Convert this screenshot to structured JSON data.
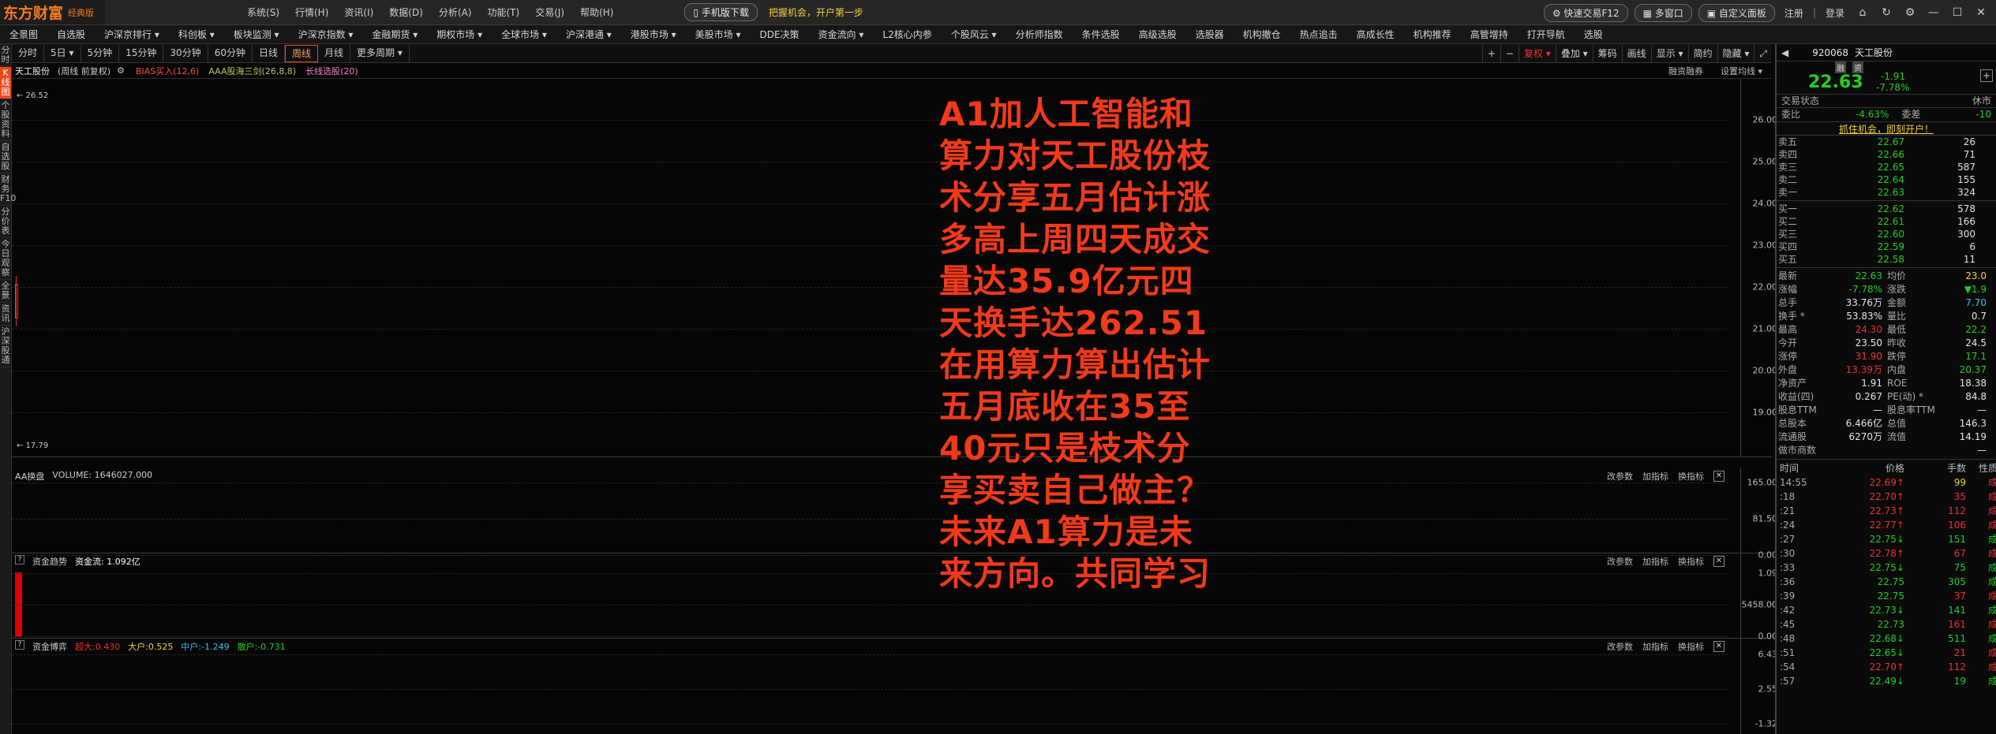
{
  "app": {
    "logo": "东方财富",
    "edition": "经典版"
  },
  "menu": [
    "系统(S)",
    "行情(H)",
    "资讯(I)",
    "数据(D)",
    "分析(A)",
    "功能(T)",
    "交易(J)",
    "帮助(H)"
  ],
  "menu_buttons": {
    "mobile": "手机版下载",
    "promo": "把握机会，开户第一步",
    "fast_trade": "快速交易F12",
    "multi_window": "多窗口",
    "custom_panel": "自定义面板",
    "register": "注册",
    "login": "登录"
  },
  "nav": [
    "全景图",
    "自选股",
    "沪深京排行 ▾",
    "科创板 ▾",
    "板块监测 ▾",
    "沪深京指数 ▾",
    "金融期货 ▾",
    "期权市场 ▾",
    "全球市场 ▾",
    "沪深港通 ▾",
    "港股市场 ▾",
    "美股市场 ▾",
    "DDE决策",
    "资金流向 ▾",
    "L2核心内参",
    "个股风云 ▾",
    "分析师指数",
    "条件选股",
    "高级选股",
    "选股器",
    "机构撤仓",
    "热点追击",
    "高成长性",
    "机构推荐",
    "高管增持",
    "打开导航",
    "选股"
  ],
  "left_tabs": [
    {
      "label": "分时",
      "on": false
    },
    {
      "label": "K线图",
      "on": true
    },
    {
      "label": "个股资料",
      "on": false
    },
    {
      "label": "自选股",
      "on": false
    },
    {
      "label": "财务F10",
      "on": false
    },
    {
      "label": "分价表",
      "on": false
    },
    {
      "label": "今日观察",
      "on": false
    },
    {
      "label": "全景",
      "on": false
    },
    {
      "label": "资讯",
      "on": false
    },
    {
      "label": "沪深股通",
      "on": false
    }
  ],
  "periods": [
    {
      "label": "分时",
      "on": false
    },
    {
      "label": "5日 ▾",
      "on": false
    },
    {
      "label": "5分钟",
      "on": false
    },
    {
      "label": "15分钟",
      "on": false
    },
    {
      "label": "30分钟",
      "on": false
    },
    {
      "label": "60分钟",
      "on": false
    },
    {
      "label": "日线",
      "on": false
    },
    {
      "label": "周线",
      "on": true
    },
    {
      "label": "月线",
      "on": false
    },
    {
      "label": "更多周期 ▾",
      "on": false
    }
  ],
  "right_tools": [
    {
      "label": "+",
      "red": false
    },
    {
      "label": "−",
      "red": false
    },
    {
      "label": "复权 ▾",
      "red": true
    },
    {
      "label": "叠加 ▾",
      "red": false
    },
    {
      "label": "筹码",
      "red": false
    },
    {
      "label": "画线",
      "red": false
    },
    {
      "label": "显示 ▾",
      "red": false
    },
    {
      "label": "简约",
      "red": false
    },
    {
      "label": "隐藏 ▾",
      "red": false
    },
    {
      "label": "⤢",
      "red": false
    }
  ],
  "chart_header": {
    "symbol": "天工股份",
    "mode": "(周线 前复权)",
    "ind1": "BIAS买入(12,6)",
    "ind2": "AAA股海三剑(26,8,8)",
    "ind3": "长线选股(20)",
    "btn1": "融资融券",
    "btn2": "设置均线 ▾"
  },
  "main_pane": {
    "high_marker": "← 26.52",
    "low_marker": "← 17.79",
    "ticks": [
      "26.00",
      "25.00",
      "24.00",
      "23.00",
      "22.00",
      "21.00",
      "20.00",
      "19.00"
    ]
  },
  "volume_pane": {
    "title": "AA换盘",
    "value": "VOLUME: 1646027.000",
    "ticks": [
      "165.00",
      "81.50",
      "0.00"
    ],
    "btns": [
      "改参数",
      "加指标",
      "换指标"
    ]
  },
  "fund_pane": {
    "title": "资金趋势",
    "value": "资金流: 1.092亿",
    "ticks": [
      "1.09",
      "5458.00",
      "0.00"
    ],
    "btns": [
      "改参数",
      "加指标",
      "换指标"
    ]
  },
  "flow_pane": {
    "title": "资金博弈",
    "super": "超大:0.430",
    "large": "大户:0.525",
    "mid": "中户:-1.249",
    "small": "散户:-0.731",
    "ticks": [
      "6.43",
      "2.55",
      "-1.32"
    ],
    "btns": [
      "改参数",
      "加指标",
      "换指标"
    ]
  },
  "overlay_text": [
    "A1加人工智能和",
    "算力对天工股份枝",
    "术分享五月估计涨",
    "多高上周四天成交",
    "量达35.9亿元四",
    "天换手达262.51",
    "在用算力算出估计",
    "五月底收在35至",
    "40元只是枝术分",
    "享买卖自己做主？",
    "未来A1算力是未",
    "来方向。共同学习"
  ],
  "quote": {
    "code": "920068",
    "name": "天工股份",
    "price": "22.63",
    "change": "-1.91",
    "pct": "-7.78%",
    "badge1": "融",
    "badge2": "资"
  },
  "trade_status": {
    "label": "交易状态",
    "status": "休市"
  },
  "weibi": {
    "label1": "委比",
    "value1": "-4.63%",
    "label2": "委差",
    "value2": "-10"
  },
  "promo_link": "抓住机会，即刻开户！",
  "asks": [
    {
      "lbl": "卖五",
      "p": "22.67",
      "v": "26"
    },
    {
      "lbl": "卖四",
      "p": "22.66",
      "v": "71"
    },
    {
      "lbl": "卖三",
      "p": "22.65",
      "v": "587"
    },
    {
      "lbl": "卖二",
      "p": "22.64",
      "v": "155"
    },
    {
      "lbl": "卖一",
      "p": "22.63",
      "v": "324"
    }
  ],
  "bids": [
    {
      "lbl": "买一",
      "p": "22.62",
      "v": "578"
    },
    {
      "lbl": "买二",
      "p": "22.61",
      "v": "166"
    },
    {
      "lbl": "买三",
      "p": "22.60",
      "v": "300"
    },
    {
      "lbl": "买四",
      "p": "22.59",
      "v": "6"
    },
    {
      "lbl": "买五",
      "p": "22.58",
      "v": "11"
    }
  ],
  "stats": [
    {
      "a": "最新",
      "av": "22.63",
      "ac": "grn",
      "b": "均价",
      "bv": "23.0",
      "bc": "yel"
    },
    {
      "a": "涨幅",
      "av": "-7.78%",
      "ac": "grn",
      "b": "涨跌",
      "bv": "▼1.9",
      "bc": "grn"
    },
    {
      "a": "总手",
      "av": "33.76万",
      "ac": "wh",
      "b": "金额",
      "bv": "7.70",
      "bc": "cyan"
    },
    {
      "a": "换手 *",
      "av": "53.83%",
      "ac": "wh",
      "b": "量比",
      "bv": "0.7",
      "bc": "wh"
    },
    {
      "a": "最高",
      "av": "24.30",
      "ac": "red",
      "b": "最低",
      "bv": "22.2",
      "bc": "grn"
    },
    {
      "a": "今开",
      "av": "23.50",
      "ac": "wh",
      "b": "昨收",
      "bv": "24.5",
      "bc": "wh"
    },
    {
      "a": "涨停",
      "av": "31.90",
      "ac": "red",
      "b": "跌停",
      "bv": "17.1",
      "bc": "grn"
    },
    {
      "a": "外盘",
      "av": "13.39万",
      "ac": "red",
      "b": "内盘",
      "bv": "20.37",
      "bc": "grn"
    },
    {
      "a": "净资产",
      "av": "1.91",
      "ac": "wh",
      "b": "ROE",
      "bv": "18.38",
      "bc": "wh"
    },
    {
      "a": "收益(四)",
      "av": "0.267",
      "ac": "wh",
      "b": "PE(动) *",
      "bv": "84.8",
      "bc": "wh"
    },
    {
      "a": "股息TTM",
      "av": "—",
      "ac": "wh",
      "b": "股息率TTM",
      "bv": "—",
      "bc": "wh"
    },
    {
      "a": "总股本",
      "av": "6.466亿",
      "ac": "wh",
      "b": "总值",
      "bv": "146.3",
      "bc": "wh"
    },
    {
      "a": "流通股",
      "av": "6270万",
      "ac": "wh",
      "b": "流值",
      "bv": "14.19",
      "bc": "wh"
    },
    {
      "a": "做市商数",
      "av": "",
      "ac": "wh",
      "b": "",
      "bv": "—",
      "bc": "wh"
    }
  ],
  "ticks_header": {
    "time": "时间",
    "price": "价格",
    "qty": "手数",
    "type": "性质"
  },
  "ticks": [
    {
      "t": "14:55",
      "p": "22.69↑",
      "pc": "red",
      "n": "99",
      "nc": "yel",
      "k": "成",
      "kc": "red"
    },
    {
      "t": ":18",
      "p": "22.70↑",
      "pc": "red",
      "n": "35",
      "nc": "red",
      "k": "成",
      "kc": "red"
    },
    {
      "t": ":21",
      "p": "22.73↑",
      "pc": "red",
      "n": "112",
      "nc": "red",
      "k": "成",
      "kc": "red"
    },
    {
      "t": ":24",
      "p": "22.77↑",
      "pc": "red",
      "n": "106",
      "nc": "red",
      "k": "成",
      "kc": "red"
    },
    {
      "t": ":27",
      "p": "22.75↓",
      "pc": "grn",
      "n": "151",
      "nc": "grn",
      "k": "成",
      "kc": "grn"
    },
    {
      "t": ":30",
      "p": "22.78↑",
      "pc": "red",
      "n": "67",
      "nc": "red",
      "k": "成",
      "kc": "red"
    },
    {
      "t": ":33",
      "p": "22.75↓",
      "pc": "grn",
      "n": "75",
      "nc": "grn",
      "k": "成",
      "kc": "grn"
    },
    {
      "t": ":36",
      "p": "22.75",
      "pc": "grn",
      "n": "305",
      "nc": "grn",
      "k": "成",
      "kc": "grn"
    },
    {
      "t": ":39",
      "p": "22.75",
      "pc": "grn",
      "n": "37",
      "nc": "red",
      "k": "成",
      "kc": "red"
    },
    {
      "t": ":42",
      "p": "22.73↓",
      "pc": "grn",
      "n": "141",
      "nc": "grn",
      "k": "成",
      "kc": "grn"
    },
    {
      "t": ":45",
      "p": "22.73",
      "pc": "grn",
      "n": "161",
      "nc": "red",
      "k": "成",
      "kc": "red"
    },
    {
      "t": ":48",
      "p": "22.68↓",
      "pc": "grn",
      "n": "511",
      "nc": "grn",
      "k": "成",
      "kc": "grn"
    },
    {
      "t": ":51",
      "p": "22.65↓",
      "pc": "grn",
      "n": "21",
      "nc": "red",
      "k": "成",
      "kc": "red"
    },
    {
      "t": ":54",
      "p": "22.70↑",
      "pc": "red",
      "n": "112",
      "nc": "red",
      "k": "成",
      "kc": "red"
    },
    {
      "t": ":57",
      "p": "22.49↓",
      "pc": "grn",
      "n": "19",
      "nc": "grn",
      "k": "成",
      "kc": "grn"
    }
  ]
}
